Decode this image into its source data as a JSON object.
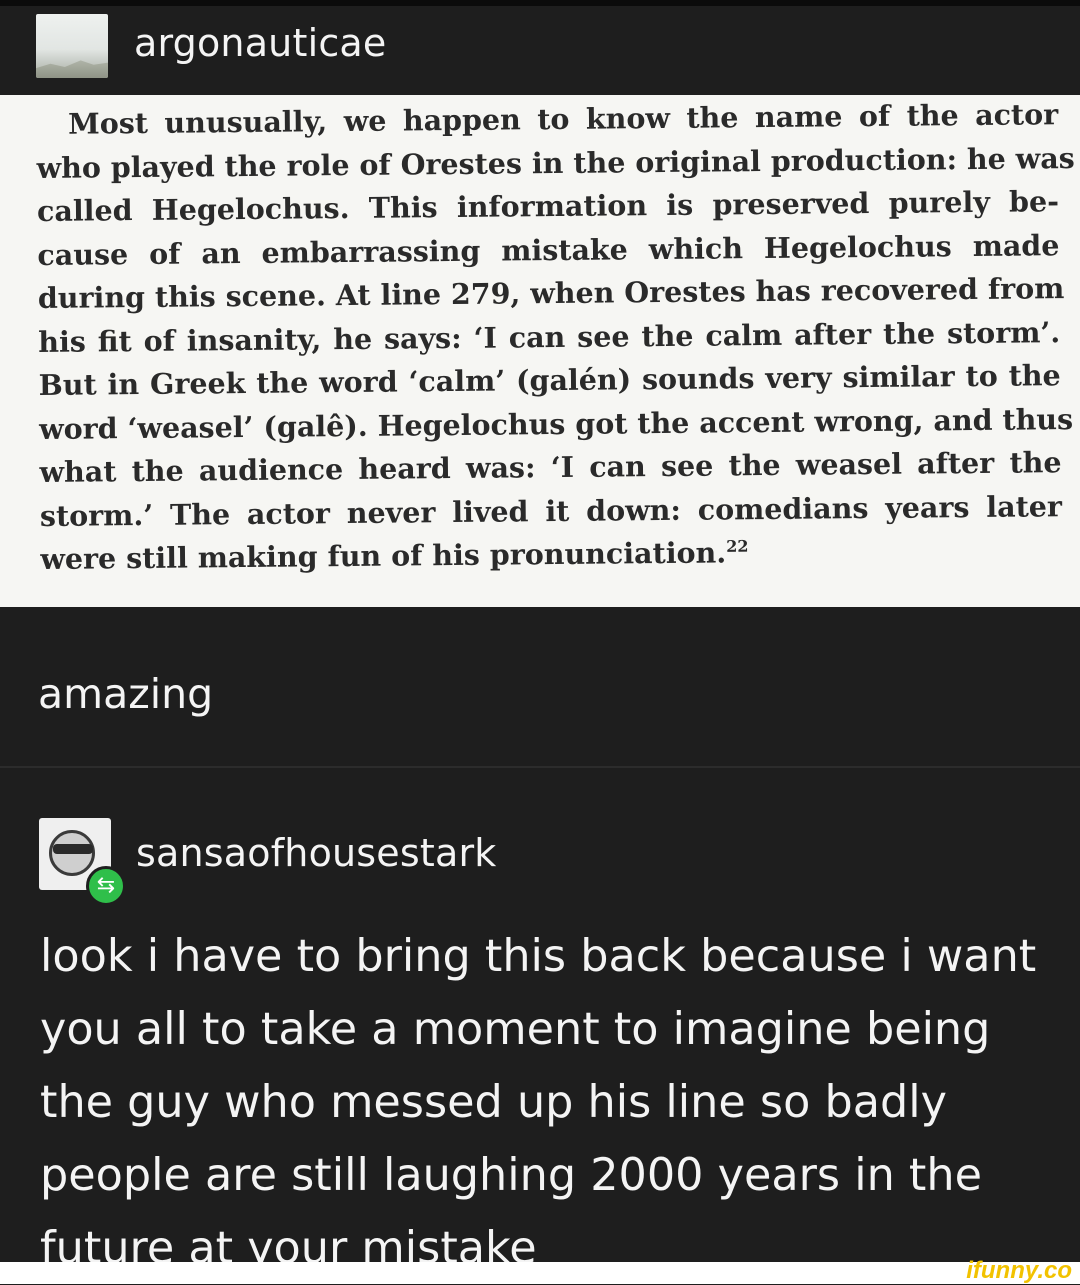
{
  "post": {
    "author": "argonauticae",
    "excerpt_lines": [
      "Most unusually, we happen to know the name of the actor",
      "who played the role of Orestes in the original production: he was",
      "called Hegelochus. This information is preserved purely be-",
      "cause of an embarrassing mistake which Hegelochus made",
      "during this scene. At line 279, when Orestes has recovered from",
      "his fit of insanity, he says: ‘I can see the calm after the storm’.",
      "But in Greek the word ‘calm’ (galén) sounds very similar to the",
      "word ‘weasel’ (galê). Hegelochus got the accent wrong, and thus",
      "what the audience heard was: ‘I can see the weasel after the",
      "storm.’ The actor never lived it down: comedians years later",
      "were still making fun of his pronunciation."
    ],
    "footnote": "22",
    "comment": "amazing"
  },
  "reblog": {
    "author": "sansaofhousestark",
    "body_lines": [
      "look i have to bring this back because i want",
      "you all to take a moment to imagine being",
      "the guy who messed up his line so badly",
      "people are still laughing 2000 years in the",
      "future at your mistake"
    ]
  },
  "watermark": "ifunny.co",
  "colors": {
    "background": "#1e1e1e",
    "excerpt_paper": "#f6f6f3",
    "reblog_badge": "#2fbf4a",
    "watermark": "#f2c200"
  }
}
